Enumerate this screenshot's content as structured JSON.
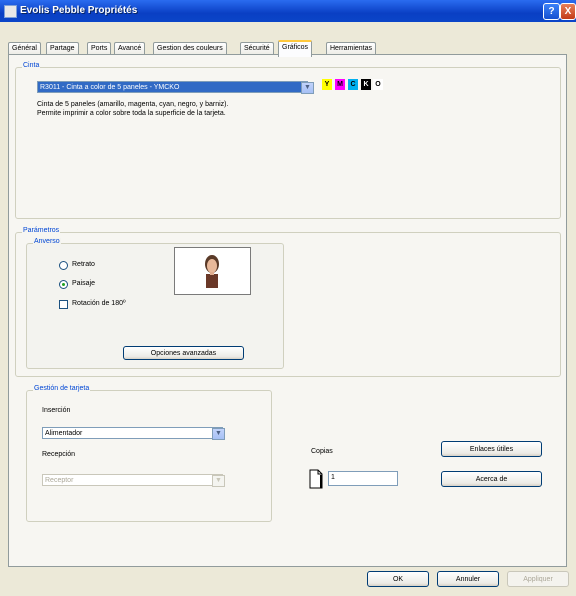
{
  "window": {
    "title": "Evolis Pebble Propriétés",
    "help_label": "?",
    "close_label": "X"
  },
  "tabs": [
    {
      "label": "Général",
      "active": false
    },
    {
      "label": "Partage",
      "active": false
    },
    {
      "label": "Ports",
      "active": false
    },
    {
      "label": "Avancé",
      "active": false
    },
    {
      "label": "Gestion des couleurs",
      "active": false
    },
    {
      "label": "Sécurité",
      "active": false
    },
    {
      "label": "Gráficos",
      "active": true
    },
    {
      "label": "Herramientas",
      "active": false
    }
  ],
  "cinta": {
    "legend": "Cinta",
    "ribbon_value": "R3011 - Cinta a color de 5 paneles - YMCKO",
    "dropdown_icon": "chevron-down-icon",
    "panels": [
      {
        "letter": "Y",
        "color": "#ffff00",
        "text_color": "#000000"
      },
      {
        "letter": "M",
        "color": "#ff00ff",
        "text_color": "#000000"
      },
      {
        "letter": "C",
        "color": "#00b0f0",
        "text_color": "#000000"
      },
      {
        "letter": "K",
        "color": "#000000",
        "text_color": "#ffffff"
      },
      {
        "letter": "O",
        "color": "#ffffff",
        "text_color": "#000000"
      }
    ],
    "description_line1": "Cinta de 5 paneles (amarillo, magenta, cyan, negro, y barniz).",
    "description_line2": "Permite imprimir a color sobre toda la superficie de la tarjeta."
  },
  "parametros": {
    "legend": "Parámetros",
    "anverso": {
      "legend": "Anverso",
      "portrait_label": "Retrato",
      "landscape_label": "Paisaje",
      "orientation_selected": "Paisaje",
      "rotation_label": "Rotación de 180º",
      "rotation_checked": false,
      "advanced_button": "Opciones avanzadas"
    }
  },
  "gestion": {
    "legend": "Gestión de tarjeta",
    "insertion_label": "Inserción",
    "insertion_value": "Alimentador",
    "reception_label": "Recepción",
    "reception_value": "Receptor",
    "dropdown_icon": "chevron-down-icon"
  },
  "copies": {
    "label": "Copias",
    "value": "1",
    "icon": "document-icon"
  },
  "side_buttons": {
    "useful_links": "Enlaces útiles",
    "about": "Acerca de"
  },
  "footer": {
    "ok": "OK",
    "cancel": "Annuler",
    "apply": "Appliquer"
  }
}
